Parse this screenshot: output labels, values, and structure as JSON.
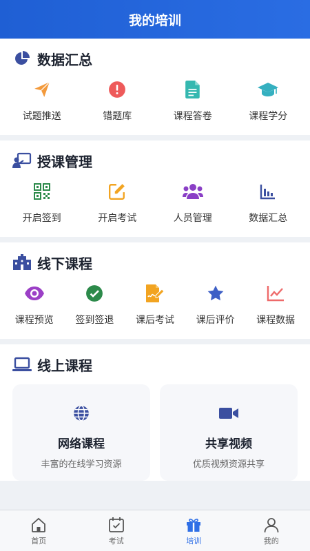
{
  "header": {
    "title": "我的培训"
  },
  "sections": {
    "data_summary": {
      "title": "数据汇总",
      "items": [
        {
          "label": "试题推送",
          "icon": "paper-plane-icon"
        },
        {
          "label": "错题库",
          "icon": "alert-circle-icon"
        },
        {
          "label": "课程答卷",
          "icon": "document-icon"
        },
        {
          "label": "课程学分",
          "icon": "graduation-cap-icon"
        }
      ]
    },
    "teaching_mgmt": {
      "title": "授课管理",
      "items": [
        {
          "label": "开启签到",
          "icon": "qrcode-icon"
        },
        {
          "label": "开启考试",
          "icon": "edit-icon"
        },
        {
          "label": "人员管理",
          "icon": "users-icon"
        },
        {
          "label": "数据汇总",
          "icon": "bar-chart-icon"
        }
      ]
    },
    "offline_course": {
      "title": "线下课程",
      "items": [
        {
          "label": "课程预览",
          "icon": "eye-icon"
        },
        {
          "label": "签到签退",
          "icon": "check-circle-icon"
        },
        {
          "label": "课后考试",
          "icon": "signature-icon"
        },
        {
          "label": "课后评价",
          "icon": "star-icon"
        },
        {
          "label": "课程数据",
          "icon": "line-chart-icon"
        }
      ]
    },
    "online_course": {
      "title": "线上课程",
      "cards": [
        {
          "title": "网络课程",
          "desc": "丰富的在线学习资源",
          "icon": "globe-icon"
        },
        {
          "title": "共享视频",
          "desc": "优质视频资源共享",
          "icon": "video-camera-icon"
        }
      ]
    }
  },
  "tabbar": {
    "items": [
      {
        "label": "首页",
        "icon": "home-icon"
      },
      {
        "label": "考试",
        "icon": "calendar-check-icon"
      },
      {
        "label": "培训",
        "icon": "gift-icon",
        "active": true
      },
      {
        "label": "我的",
        "icon": "user-icon"
      }
    ]
  },
  "colors": {
    "primary": "#2f6fe6",
    "header_bg": "#2265dc"
  }
}
